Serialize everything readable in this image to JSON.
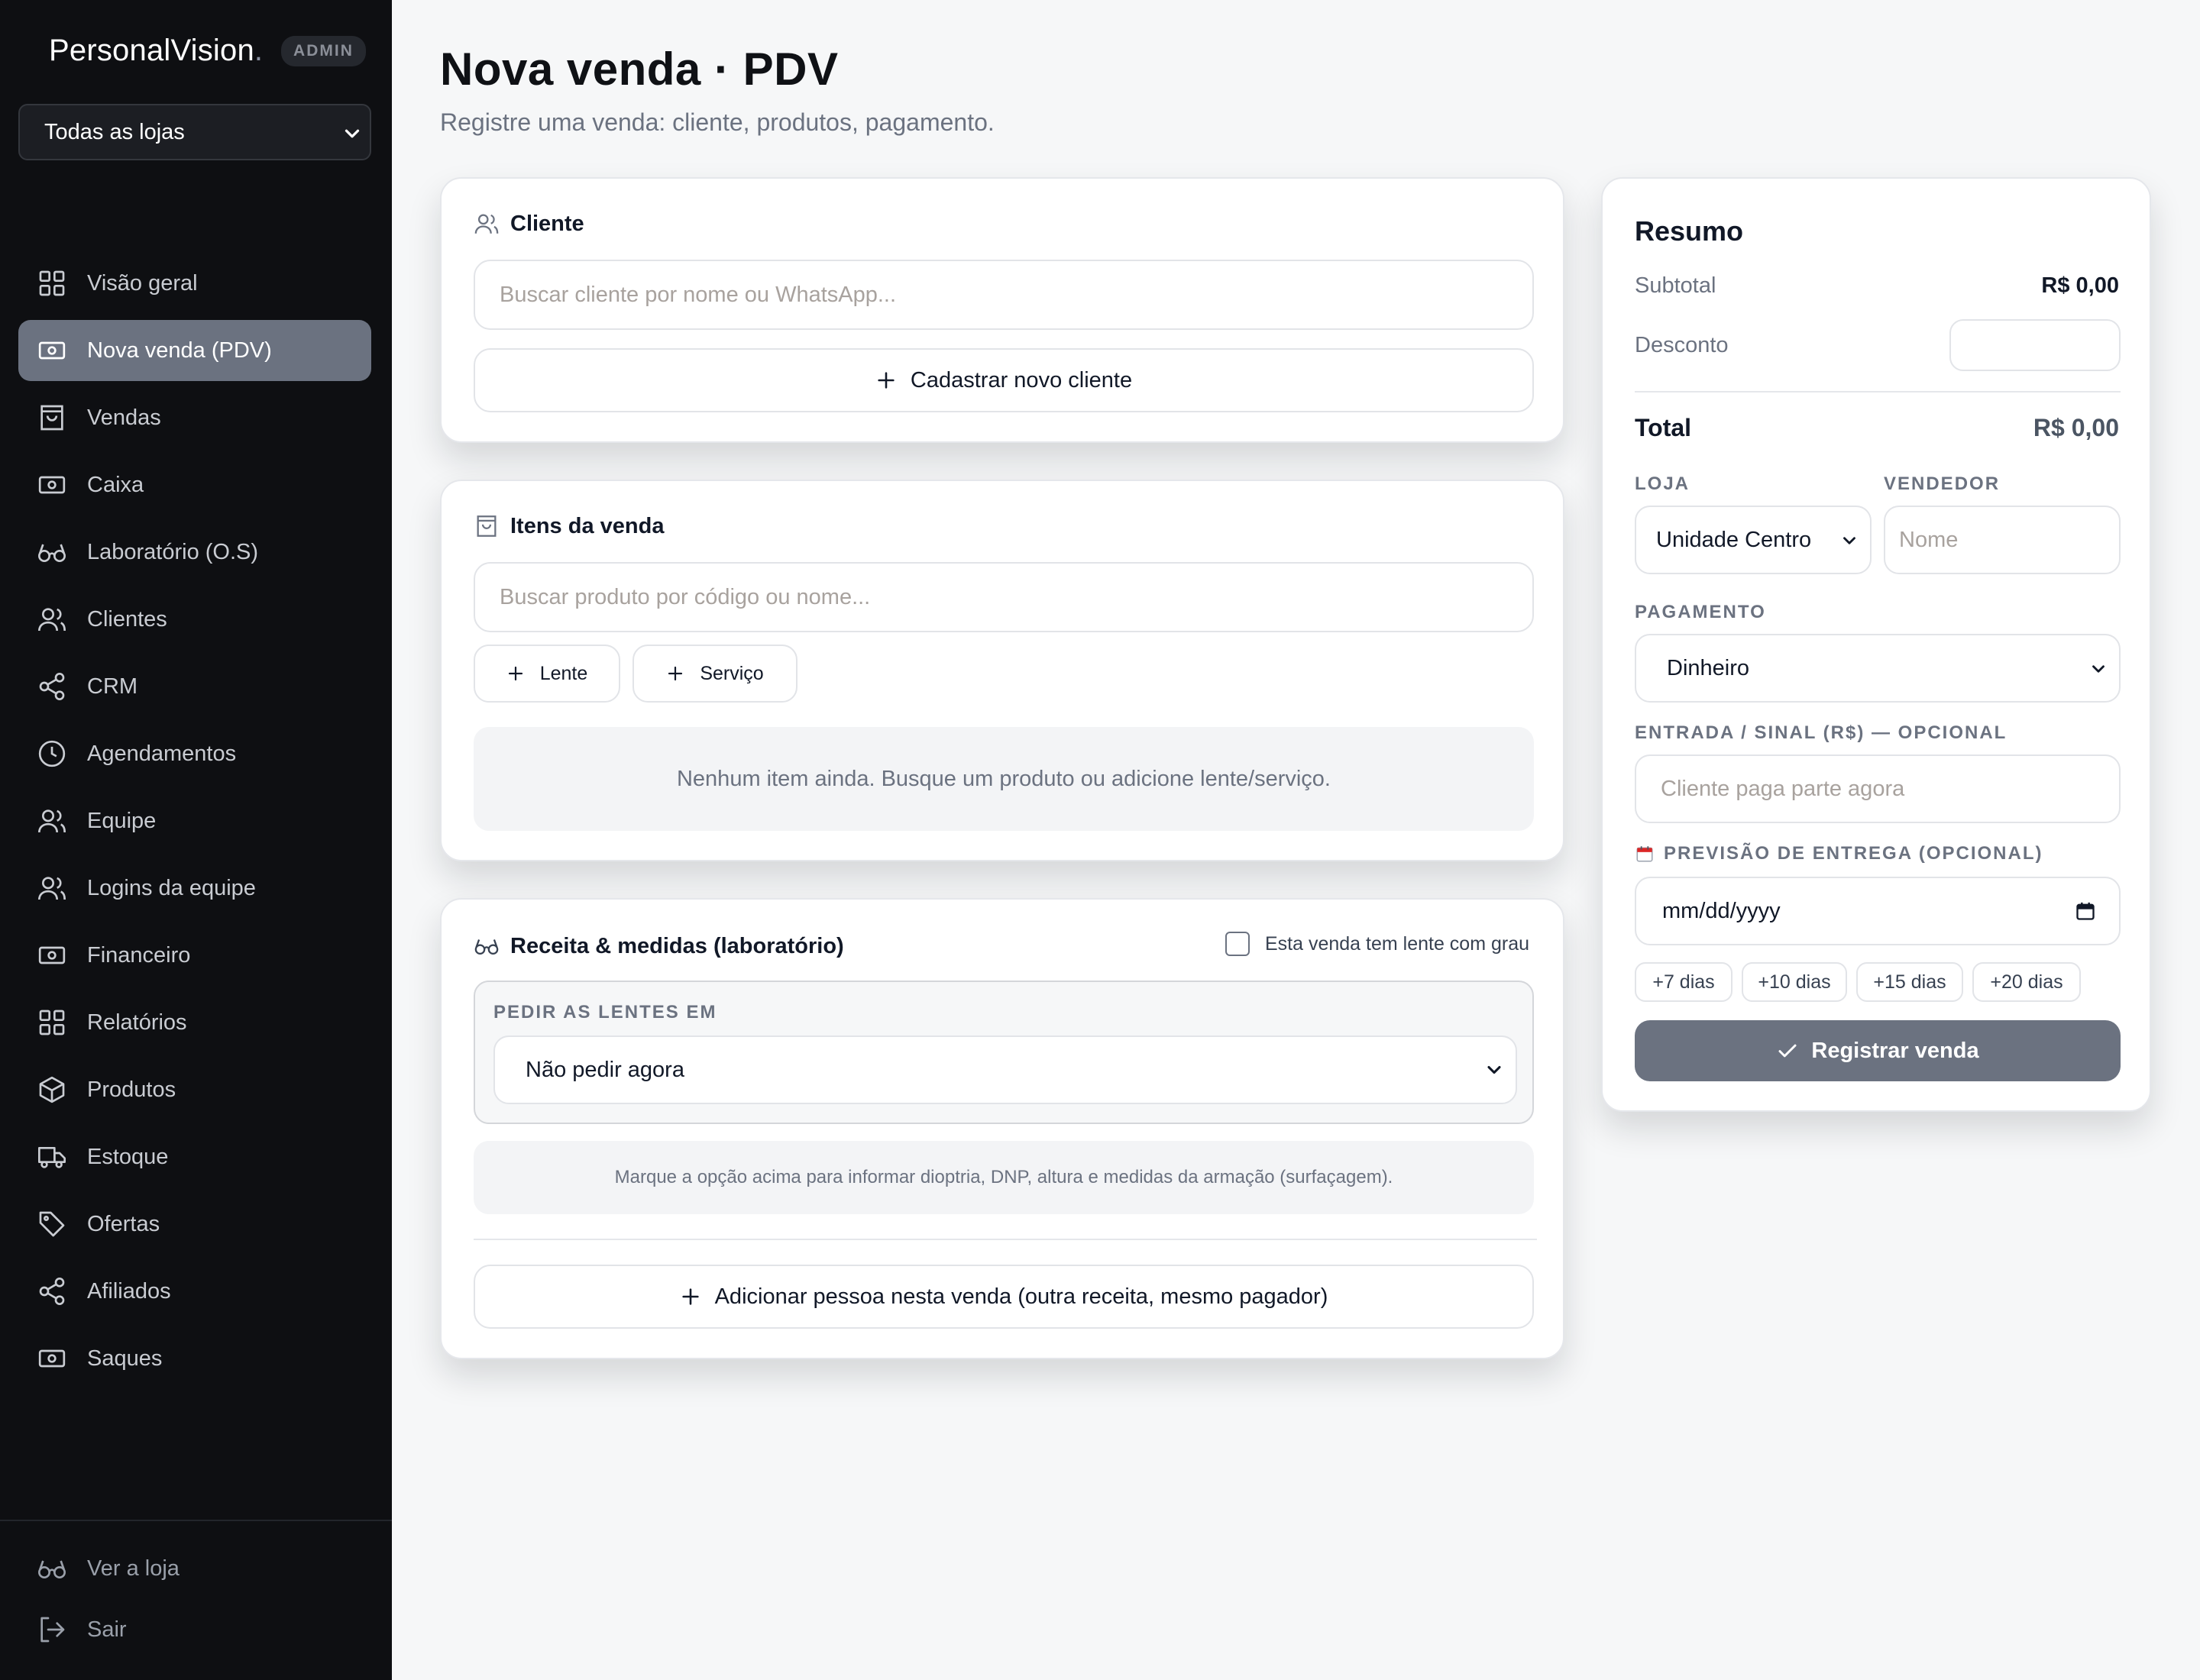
{
  "sidebar": {
    "brand": "PersonalVision",
    "brand_dot": ".",
    "badge": "ADMIN",
    "store_select": "Todas as lojas",
    "items": [
      {
        "label": "Visão geral",
        "icon": "grid-icon"
      },
      {
        "label": "Nova venda (PDV)",
        "icon": "cash-icon",
        "active": true
      },
      {
        "label": "Vendas",
        "icon": "bag-icon"
      },
      {
        "label": "Caixa",
        "icon": "cash-icon"
      },
      {
        "label": "Laboratório (O.S)",
        "icon": "glasses-icon"
      },
      {
        "label": "Clientes",
        "icon": "users-icon"
      },
      {
        "label": "CRM",
        "icon": "share-icon"
      },
      {
        "label": "Agendamentos",
        "icon": "clock-icon"
      },
      {
        "label": "Equipe",
        "icon": "users-icon"
      },
      {
        "label": "Logins da equipe",
        "icon": "users-icon"
      },
      {
        "label": "Financeiro",
        "icon": "cash-icon"
      },
      {
        "label": "Relatórios",
        "icon": "grid-icon"
      },
      {
        "label": "Produtos",
        "icon": "box-icon"
      },
      {
        "label": "Estoque",
        "icon": "truck-icon"
      },
      {
        "label": "Ofertas",
        "icon": "tag-icon"
      },
      {
        "label": "Afiliados",
        "icon": "share-icon"
      },
      {
        "label": "Saques",
        "icon": "cash-icon"
      }
    ],
    "footer": {
      "view_store": "Ver a loja",
      "logout": "Sair"
    }
  },
  "header": {
    "title": "Nova venda · PDV",
    "subtitle": "Registre uma venda: cliente, produtos, pagamento."
  },
  "cliente": {
    "title": "Cliente",
    "search_placeholder": "Buscar cliente por nome ou WhatsApp...",
    "new_client": "Cadastrar novo cliente"
  },
  "itens": {
    "title": "Itens da venda",
    "search_placeholder": "Buscar produto por código ou nome...",
    "add_lens": "Lente",
    "add_service": "Serviço",
    "empty": "Nenhum item ainda. Busque um produto ou adicione lente/serviço."
  },
  "receita": {
    "title": "Receita & medidas (laboratório)",
    "checkbox_label": "Esta venda tem lente com grau",
    "checkbox_checked": false,
    "order_label": "PEDIR AS LENTES EM",
    "order_value": "Não pedir agora",
    "hint": "Marque a opção acima para informar dioptria, DNP, altura e medidas da armação (surfaçagem).",
    "add_person": "Adicionar pessoa nesta venda (outra receita, mesmo pagador)"
  },
  "resumo": {
    "title": "Resumo",
    "subtotal_label": "Subtotal",
    "subtotal_value": "R$ 0,00",
    "discount_label": "Desconto",
    "discount_value": "",
    "total_label": "Total",
    "total_value": "R$ 0,00",
    "store_label": "LOJA",
    "store_value": "Unidade Centro",
    "seller_label": "VENDEDOR",
    "seller_placeholder": "Nome",
    "payment_label": "PAGAMENTO",
    "payment_value": "Dinheiro",
    "down_label": "ENTRADA / SINAL (R$) — OPCIONAL",
    "down_placeholder": "Cliente paga parte agora",
    "delivery_label": "PREVISÃO DE ENTREGA (OPCIONAL)",
    "delivery_value": "mm/dd/yyyy",
    "chips": [
      "+7 dias",
      "+10 dias",
      "+15 dias",
      "+20 dias"
    ],
    "submit": "Registrar venda"
  },
  "colors": {
    "sidebar_bg": "#0e0f12",
    "active_item": "#6b7280",
    "submit_bg": "#6b7280",
    "page_bg": "#f6f7f8"
  }
}
